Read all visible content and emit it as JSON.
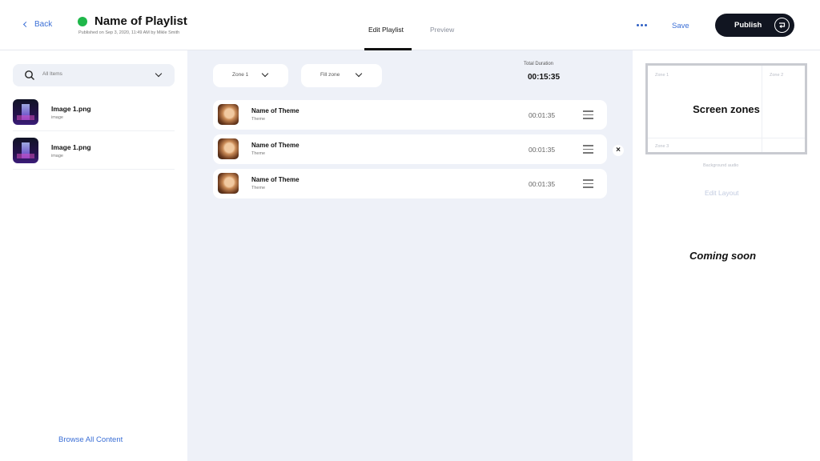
{
  "header": {
    "back_label": "Back",
    "playlist_title": "Name of Playlist",
    "published_info": "Published on Sep 3, 2020, 11:49 AM by Mikle Smith",
    "tabs": [
      {
        "label": "Edit Playlist",
        "active": true
      },
      {
        "label": "Preview",
        "active": false
      }
    ],
    "save_label": "Save",
    "publish_label": "Publish",
    "status_color": "#1fb74a"
  },
  "left": {
    "filter_label": "All Items",
    "items": [
      {
        "name": "Image 1.png",
        "type": "image"
      },
      {
        "name": "Image 1.png",
        "type": "image"
      }
    ],
    "browse_label": "Browse All Content"
  },
  "center": {
    "zone_select": "Zone 1",
    "fill_select": "Fill zone",
    "total_duration_label": "Total Duration",
    "total_duration": "00:15:35",
    "rows": [
      {
        "name": "Name of Theme",
        "sub": "Theme",
        "time": "00:01:35"
      },
      {
        "name": "Name of Theme",
        "sub": "Theme",
        "time": "00:01:35"
      },
      {
        "name": "Name of Theme",
        "sub": "Theme",
        "time": "00:01:35"
      }
    ]
  },
  "right": {
    "zone_1": "Zone 1",
    "zone_2": "Zone 2",
    "zone_3": "Zone 3",
    "screen_zones_title": "Screen zones",
    "background_audio": "Background audio",
    "edit_layout": "Edit Layout",
    "coming_soon": "Coming soon"
  }
}
